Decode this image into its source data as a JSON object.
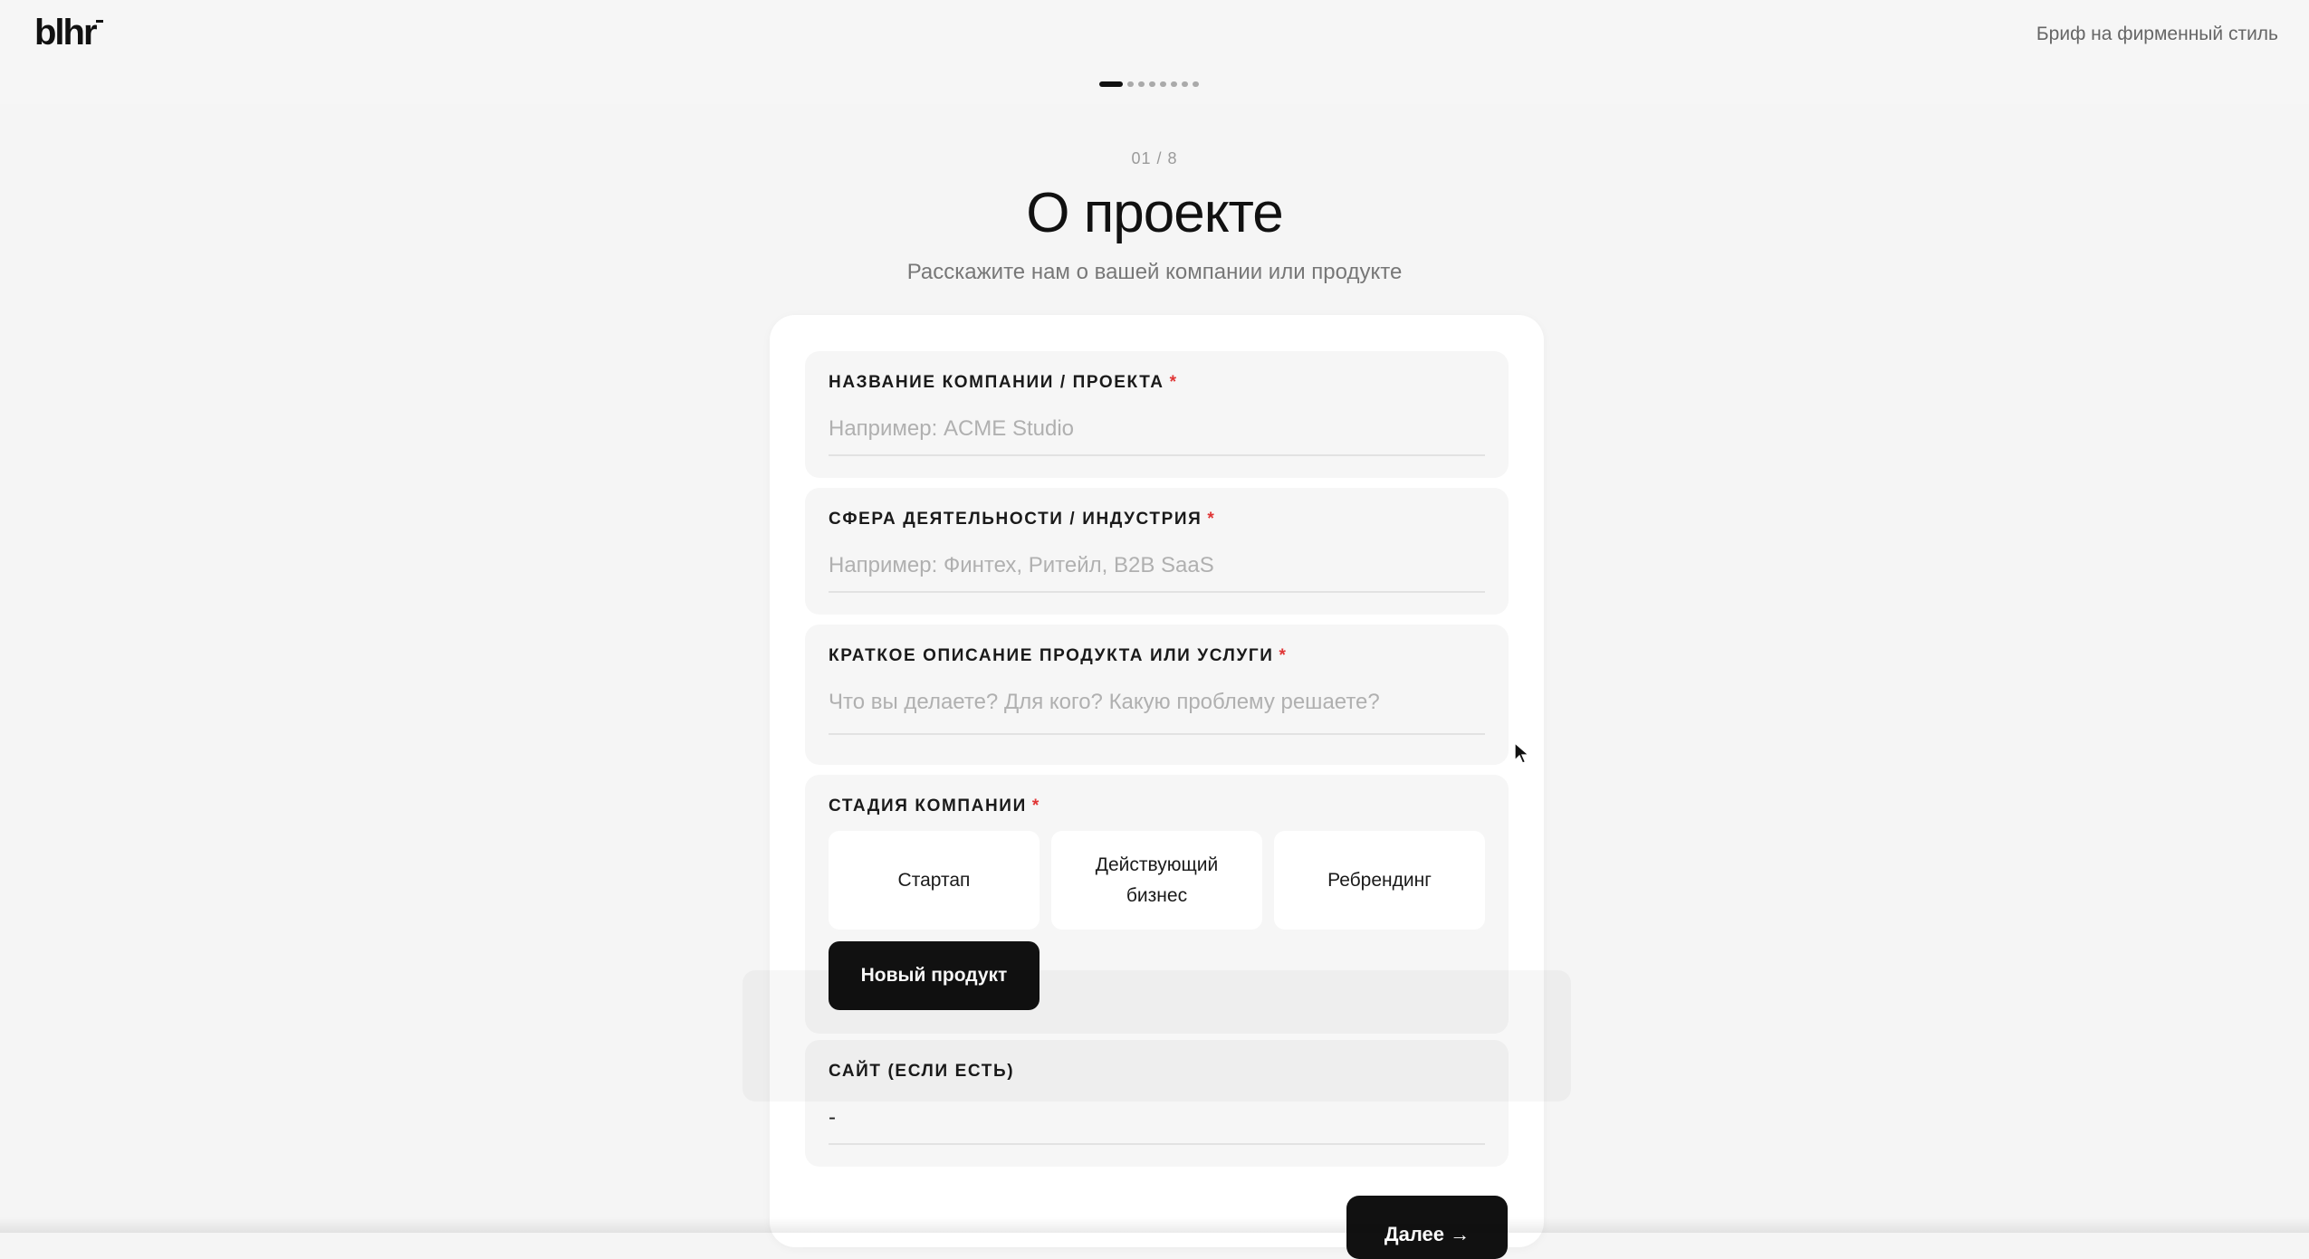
{
  "header": {
    "logo": "blhr",
    "brief_link": "Бриф на фирменный стиль"
  },
  "progress": {
    "current_step": 1,
    "total_steps": 8
  },
  "step": {
    "counter": "01 / 8",
    "title": "О проекте",
    "subtitle": "Расскажите нам о вашей компании или продукте"
  },
  "form": {
    "company_name": {
      "label": "НАЗВАНИЕ КОМПАНИИ / ПРОЕКТА",
      "required_mark": "*",
      "value": "",
      "placeholder": "Например: ACME Studio"
    },
    "industry": {
      "label": "СФЕРА ДЕЯТЕЛЬНОСТИ / ИНДУСТРИЯ",
      "required_mark": "*",
      "value": "",
      "placeholder": "Например: Финтех, Ритейл, B2B SaaS"
    },
    "description": {
      "label": "КРАТКОЕ ОПИСАНИЕ ПРОДУКТА ИЛИ УСЛУГИ",
      "required_mark": "*",
      "value": "",
      "placeholder": "Что вы делаете? Для кого? Какую проблему решаете?"
    },
    "stage": {
      "label": "СТАДИЯ КОМПАНИИ",
      "required_mark": "*",
      "options": [
        "Стартап",
        "Действующий бизнес",
        "Ребрендинг",
        "Новый продукт"
      ],
      "selected": "Новый продукт"
    },
    "website": {
      "label": "САЙТ (ЕСЛИ ЕСТЬ)",
      "value": "-"
    },
    "next_button": "Далее →"
  },
  "colors": {
    "accent": "#111111",
    "required": "#e03535",
    "background": "#f5f5f5",
    "card": "#ffffff",
    "field_bg": "#f6f6f6"
  },
  "icons": [
    "mouse-pointer-icon"
  ]
}
